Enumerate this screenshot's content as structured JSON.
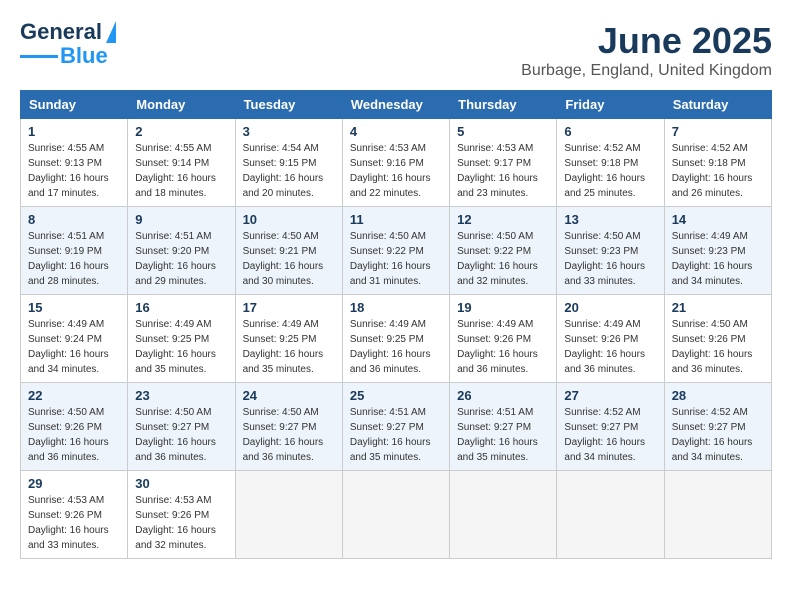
{
  "header": {
    "logo_general": "General",
    "logo_blue": "Blue",
    "month_year": "June 2025",
    "location": "Burbage, England, United Kingdom"
  },
  "weekdays": [
    "Sunday",
    "Monday",
    "Tuesday",
    "Wednesday",
    "Thursday",
    "Friday",
    "Saturday"
  ],
  "weeks": [
    [
      {
        "day": "1",
        "sunrise": "4:55 AM",
        "sunset": "9:13 PM",
        "daylight": "16 hours and 17 minutes."
      },
      {
        "day": "2",
        "sunrise": "4:55 AM",
        "sunset": "9:14 PM",
        "daylight": "16 hours and 18 minutes."
      },
      {
        "day": "3",
        "sunrise": "4:54 AM",
        "sunset": "9:15 PM",
        "daylight": "16 hours and 20 minutes."
      },
      {
        "day": "4",
        "sunrise": "4:53 AM",
        "sunset": "9:16 PM",
        "daylight": "16 hours and 22 minutes."
      },
      {
        "day": "5",
        "sunrise": "4:53 AM",
        "sunset": "9:17 PM",
        "daylight": "16 hours and 23 minutes."
      },
      {
        "day": "6",
        "sunrise": "4:52 AM",
        "sunset": "9:18 PM",
        "daylight": "16 hours and 25 minutes."
      },
      {
        "day": "7",
        "sunrise": "4:52 AM",
        "sunset": "9:18 PM",
        "daylight": "16 hours and 26 minutes."
      }
    ],
    [
      {
        "day": "8",
        "sunrise": "4:51 AM",
        "sunset": "9:19 PM",
        "daylight": "16 hours and 28 minutes."
      },
      {
        "day": "9",
        "sunrise": "4:51 AM",
        "sunset": "9:20 PM",
        "daylight": "16 hours and 29 minutes."
      },
      {
        "day": "10",
        "sunrise": "4:50 AM",
        "sunset": "9:21 PM",
        "daylight": "16 hours and 30 minutes."
      },
      {
        "day": "11",
        "sunrise": "4:50 AM",
        "sunset": "9:22 PM",
        "daylight": "16 hours and 31 minutes."
      },
      {
        "day": "12",
        "sunrise": "4:50 AM",
        "sunset": "9:22 PM",
        "daylight": "16 hours and 32 minutes."
      },
      {
        "day": "13",
        "sunrise": "4:50 AM",
        "sunset": "9:23 PM",
        "daylight": "16 hours and 33 minutes."
      },
      {
        "day": "14",
        "sunrise": "4:49 AM",
        "sunset": "9:23 PM",
        "daylight": "16 hours and 34 minutes."
      }
    ],
    [
      {
        "day": "15",
        "sunrise": "4:49 AM",
        "sunset": "9:24 PM",
        "daylight": "16 hours and 34 minutes."
      },
      {
        "day": "16",
        "sunrise": "4:49 AM",
        "sunset": "9:25 PM",
        "daylight": "16 hours and 35 minutes."
      },
      {
        "day": "17",
        "sunrise": "4:49 AM",
        "sunset": "9:25 PM",
        "daylight": "16 hours and 35 minutes."
      },
      {
        "day": "18",
        "sunrise": "4:49 AM",
        "sunset": "9:25 PM",
        "daylight": "16 hours and 36 minutes."
      },
      {
        "day": "19",
        "sunrise": "4:49 AM",
        "sunset": "9:26 PM",
        "daylight": "16 hours and 36 minutes."
      },
      {
        "day": "20",
        "sunrise": "4:49 AM",
        "sunset": "9:26 PM",
        "daylight": "16 hours and 36 minutes."
      },
      {
        "day": "21",
        "sunrise": "4:50 AM",
        "sunset": "9:26 PM",
        "daylight": "16 hours and 36 minutes."
      }
    ],
    [
      {
        "day": "22",
        "sunrise": "4:50 AM",
        "sunset": "9:26 PM",
        "daylight": "16 hours and 36 minutes."
      },
      {
        "day": "23",
        "sunrise": "4:50 AM",
        "sunset": "9:27 PM",
        "daylight": "16 hours and 36 minutes."
      },
      {
        "day": "24",
        "sunrise": "4:50 AM",
        "sunset": "9:27 PM",
        "daylight": "16 hours and 36 minutes."
      },
      {
        "day": "25",
        "sunrise": "4:51 AM",
        "sunset": "9:27 PM",
        "daylight": "16 hours and 35 minutes."
      },
      {
        "day": "26",
        "sunrise": "4:51 AM",
        "sunset": "9:27 PM",
        "daylight": "16 hours and 35 minutes."
      },
      {
        "day": "27",
        "sunrise": "4:52 AM",
        "sunset": "9:27 PM",
        "daylight": "16 hours and 34 minutes."
      },
      {
        "day": "28",
        "sunrise": "4:52 AM",
        "sunset": "9:27 PM",
        "daylight": "16 hours and 34 minutes."
      }
    ],
    [
      {
        "day": "29",
        "sunrise": "4:53 AM",
        "sunset": "9:26 PM",
        "daylight": "16 hours and 33 minutes."
      },
      {
        "day": "30",
        "sunrise": "4:53 AM",
        "sunset": "9:26 PM",
        "daylight": "16 hours and 32 minutes."
      },
      null,
      null,
      null,
      null,
      null
    ]
  ]
}
